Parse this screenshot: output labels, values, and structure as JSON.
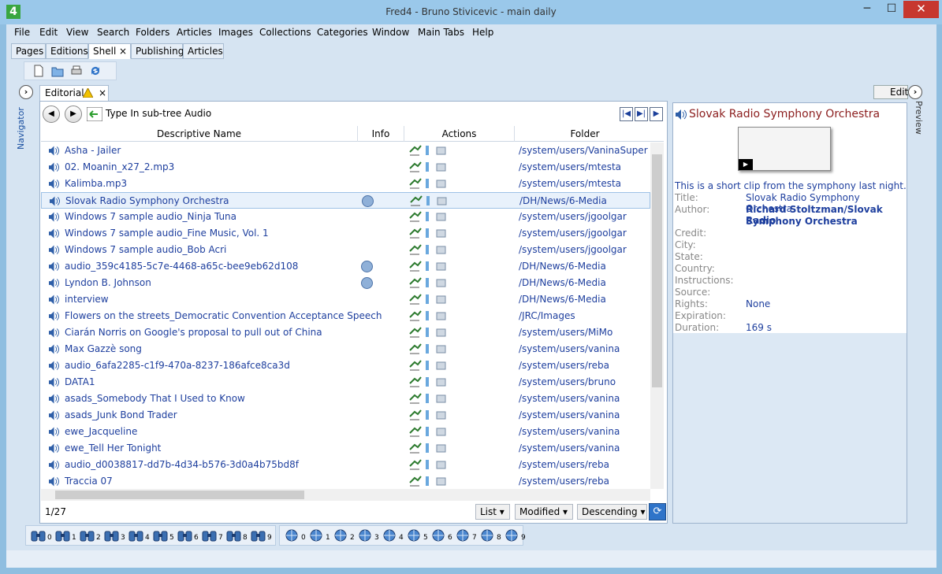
{
  "window": {
    "title": "Fred4 - Bruno Stivicevic - main daily",
    "logo": "4",
    "minimize": "─",
    "maximize": "☐",
    "close": "✕"
  },
  "menu": [
    "File",
    "Edit",
    "View",
    "Search",
    "Folders",
    "Articles",
    "Images",
    "Collections",
    "Categories",
    "Window",
    "Main Tabs",
    "Help"
  ],
  "tabs": [
    {
      "label": "Pages"
    },
    {
      "label": "Editions"
    },
    {
      "label": "Shell",
      "active": true,
      "close": "×"
    },
    {
      "label": "Publishing"
    },
    {
      "label": "Articles"
    }
  ],
  "sidebar": {
    "navigator": "Navigator",
    "preview": "Preview"
  },
  "editorial_tab": {
    "label": "Editorial",
    "close": "×",
    "icon": "warning-icon"
  },
  "navrow": {
    "path": "Type In sub-tree Audio"
  },
  "columns": {
    "name": "Descriptive Name",
    "info": "Info",
    "actions": "Actions",
    "folder": "Folder"
  },
  "rows": [
    {
      "name": "Asha - Jailer",
      "folder": "/system/users/VaninaSuper",
      "info": false
    },
    {
      "name": "02. Moanin_x27_2.mp3",
      "folder": "/system/users/mtesta",
      "info": false
    },
    {
      "name": "Kalimba.mp3",
      "folder": "/system/users/mtesta",
      "info": false
    },
    {
      "name": "Slovak Radio Symphony Orchestra",
      "folder": "/DH/News/6-Media",
      "info": true,
      "selected": true
    },
    {
      "name": "Windows 7 sample audio_Ninja Tuna",
      "folder": "/system/users/jgoolgar",
      "info": false
    },
    {
      "name": "Windows 7 sample audio_Fine Music, Vol. 1",
      "folder": "/system/users/jgoolgar",
      "info": false
    },
    {
      "name": "Windows 7 sample audio_Bob Acri",
      "folder": "/system/users/jgoolgar",
      "info": false
    },
    {
      "name": "audio_359c4185-5c7e-4468-a65c-bee9eb62d108",
      "folder": "/DH/News/6-Media",
      "info": true
    },
    {
      "name": "Lyndon B. Johnson",
      "folder": "/DH/News/6-Media",
      "info": true
    },
    {
      "name": "interview",
      "folder": "/DH/News/6-Media",
      "info": false
    },
    {
      "name": "Flowers on the streets_Democratic Convention Acceptance Speech",
      "folder": "/JRC/Images",
      "info": false
    },
    {
      "name": "Ciarán Norris on Google's proposal to pull out of China",
      "folder": "/system/users/MiMo",
      "info": false
    },
    {
      "name": "Max Gazzè song",
      "folder": "/system/users/vanina",
      "info": false
    },
    {
      "name": "audio_6afa2285-c1f9-470a-8237-186afce8ca3d",
      "folder": "/system/users/reba",
      "info": false
    },
    {
      "name": "DATA1",
      "folder": "/system/users/bruno",
      "info": false
    },
    {
      "name": "asads_Somebody That I Used to Know",
      "folder": "/system/users/vanina",
      "info": false
    },
    {
      "name": "asads_Junk Bond Trader",
      "folder": "/system/users/vanina",
      "info": false
    },
    {
      "name": "ewe_Jacqueline",
      "folder": "/system/users/vanina",
      "info": false
    },
    {
      "name": "ewe_Tell Her Tonight",
      "folder": "/system/users/vanina",
      "info": false
    },
    {
      "name": "audio_d0038817-dd7b-4d34-b576-3d0a4b75bd8f",
      "folder": "/system/users/reba",
      "info": false
    },
    {
      "name": "Traccia 07",
      "folder": "/system/users/reba",
      "info": false
    }
  ],
  "footer": {
    "count": "1/27",
    "view": "List",
    "sort_field": "Modified",
    "sort_order": "Descending"
  },
  "preview": {
    "title": "Slovak Radio Symphony Orchestra",
    "description": "This is a short clip from the symphony last night.",
    "labels": {
      "title": "Title:",
      "author": "Author:",
      "credit": "Credit:",
      "city": "City:",
      "state": "State:",
      "country": "Country:",
      "instructions": "Instructions:",
      "source": "Source:",
      "rights": "Rights:",
      "expiration": "Expiration:",
      "duration": "Duration:"
    },
    "values": {
      "title": "Slovak Radio Symphony Orchestra",
      "author_line1": "Richard Stoltzman/Slovak Radio",
      "author_line2": "Symphony Orchestra",
      "rights": "None",
      "duration": "169 s"
    },
    "edit_button": "Edit"
  },
  "bottom_digits": [
    "0",
    "1",
    "2",
    "3",
    "4",
    "5",
    "6",
    "7",
    "8",
    "9"
  ],
  "colors": {
    "link": "#1e3f9e",
    "preview_title": "#8b1d1d",
    "accent": "#2f74c9"
  }
}
